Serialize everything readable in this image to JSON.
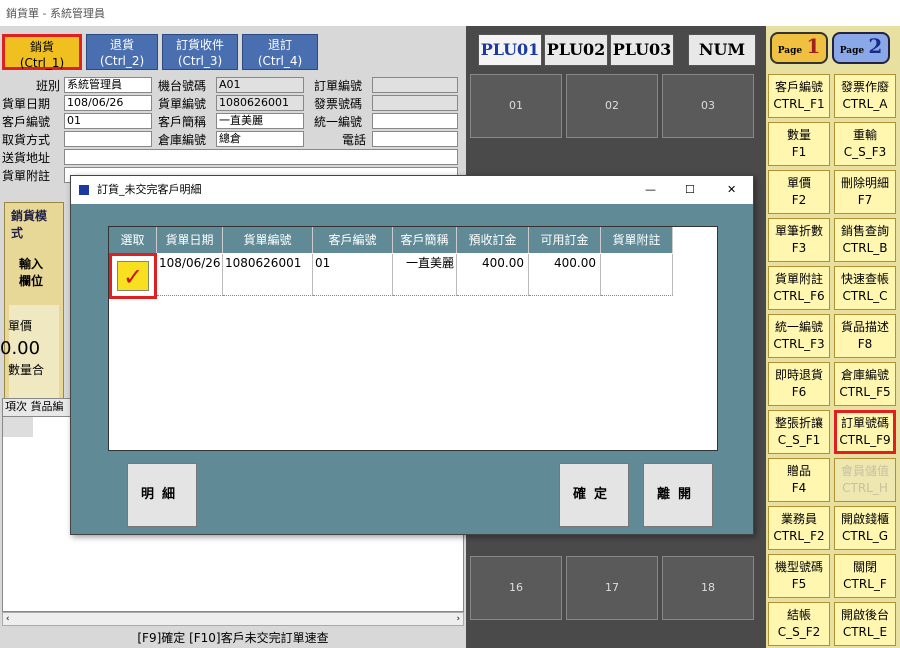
{
  "window": {
    "title": "銷貨單 - 系統管理員"
  },
  "mode_tabs": [
    {
      "label": "銷貨",
      "hotkey": "(Ctrl_1)"
    },
    {
      "label": "退貨",
      "hotkey": "(Ctrl_2)"
    },
    {
      "label": "訂貨收件",
      "hotkey": "(Ctrl_3)"
    },
    {
      "label": "退訂",
      "hotkey": "(Ctrl_4)"
    }
  ],
  "form": {
    "shift_label": "班別",
    "shift_value": "系統管理員",
    "date_label": "貨單日期",
    "date_value": "108/06/26",
    "customer_no_label": "客戶編號",
    "customer_no_value": "01",
    "pickup_label": "取貨方式",
    "pickup_value": "",
    "delivery_label": "送貨地址",
    "delivery_value": "",
    "note_label": "貨單附註",
    "note_value": "",
    "machine_label": "機台號碼",
    "machine_value": "A01",
    "doc_no_label": "貨單編號",
    "doc_no_value": "1080626001",
    "customer_name_label": "客戶簡稱",
    "customer_name_value": "一直美麗",
    "warehouse_label": "倉庫編號",
    "warehouse_value": "總倉",
    "order_no_label": "訂單編號",
    "order_no_value": "",
    "invoice_label": "發票號碼",
    "invoice_value": "",
    "tax_id_label": "統一編號",
    "tax_id_value": "",
    "phone_label": "電話",
    "phone_value": ""
  },
  "left_panel": {
    "mode_label": "銷貨模式",
    "input_label": "輸入欄位",
    "price_label": "單價",
    "price_value": "0.00",
    "qty_label": "數量合",
    "col_seq": "項次",
    "col_item": "貨品編",
    "status_text": "[F9]確定  [F10]客戶未交完訂單速查"
  },
  "plu": {
    "tabs": [
      "PLU01",
      "PLU02",
      "PLU03"
    ],
    "num_label": "NUM",
    "row1": [
      "01",
      "02",
      "03"
    ],
    "row_last": [
      "16",
      "17",
      "18"
    ]
  },
  "pages": {
    "p1": "1",
    "p2": "2",
    "prefix": "Page"
  },
  "function_keys": [
    {
      "l1": "客戶編號",
      "l2": "CTRL_F1"
    },
    {
      "l1": "發票作廢",
      "l2": "CTRL_A"
    },
    {
      "l1": "數量",
      "l2": "F1"
    },
    {
      "l1": "重輸",
      "l2": "C_S_F3"
    },
    {
      "l1": "單價",
      "l2": "F2"
    },
    {
      "l1": "刪除明細",
      "l2": "F7"
    },
    {
      "l1": "單筆折數",
      "l2": "F3"
    },
    {
      "l1": "銷售查詢",
      "l2": "CTRL_B"
    },
    {
      "l1": "貨單附註",
      "l2": "CTRL_F6"
    },
    {
      "l1": "快速查帳",
      "l2": "CTRL_C"
    },
    {
      "l1": "統一編號",
      "l2": "CTRL_F3"
    },
    {
      "l1": "貨品描述",
      "l2": "F8"
    },
    {
      "l1": "即時退貨",
      "l2": "F6"
    },
    {
      "l1": "倉庫編號",
      "l2": "CTRL_F5"
    },
    {
      "l1": "整張折讓",
      "l2": "C_S_F1"
    },
    {
      "l1": "訂單號碼",
      "l2": "CTRL_F9"
    },
    {
      "l1": "贈品",
      "l2": "F4"
    },
    {
      "l1": "會員儲值",
      "l2": "CTRL_H"
    },
    {
      "l1": "業務員",
      "l2": "CTRL_F2"
    },
    {
      "l1": "開啟錢櫃",
      "l2": "CTRL_G"
    },
    {
      "l1": "機型號碼",
      "l2": "F5"
    },
    {
      "l1": "關閉",
      "l2": "CTRL_F"
    },
    {
      "l1": "結帳",
      "l2": "C_S_F2"
    },
    {
      "l1": "開啟後台",
      "l2": "CTRL_E"
    }
  ],
  "dialog": {
    "title": "訂貨_未交完客戶明細",
    "columns": [
      "選取",
      "貨單日期",
      "貨單編號",
      "客戶編號",
      "客戶簡稱",
      "預收訂金",
      "可用訂金",
      "貨單附註"
    ],
    "rows": [
      {
        "date": "108/06/26",
        "doc_no": "1080626001",
        "cust_no": "01",
        "cust_name": "一直美麗",
        "deposit": "400.00",
        "available": "400.00",
        "note": ""
      }
    ],
    "check_mark": "✓",
    "btn_detail": "明細",
    "btn_ok": "確定",
    "btn_leave": "離開",
    "min": "—",
    "max": "☐",
    "close": "✕"
  }
}
